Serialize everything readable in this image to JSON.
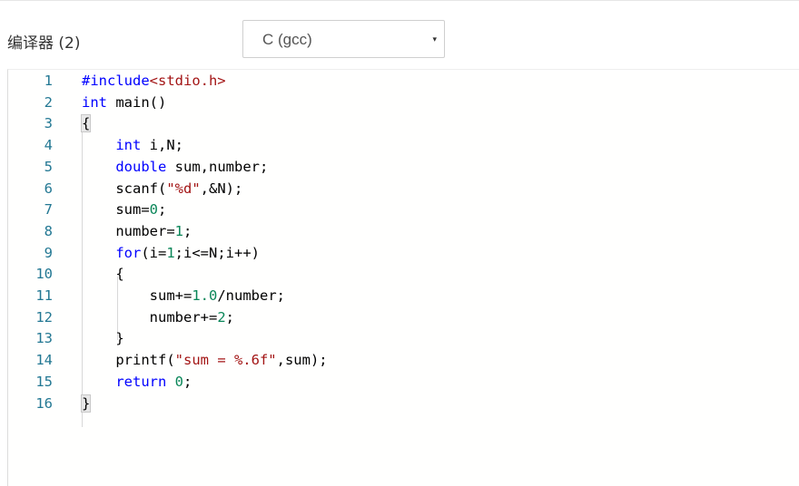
{
  "compiler": {
    "label": "编译器 (2)",
    "selected": "C (gcc)",
    "caret": "▾"
  },
  "editor": {
    "lines": [
      {
        "number": "1",
        "tokens": [
          {
            "t": "#include",
            "c": "pp"
          },
          {
            "t": "<stdio.h>",
            "c": "inc"
          }
        ]
      },
      {
        "number": "2",
        "tokens": [
          {
            "t": "int",
            "c": "kw"
          },
          {
            "t": " main()",
            "c": "id"
          }
        ]
      },
      {
        "number": "3",
        "tokens": [
          {
            "t": "{",
            "c": "id",
            "hl": true
          }
        ]
      },
      {
        "number": "4",
        "tokens": [
          {
            "t": "    ",
            "c": "id"
          },
          {
            "t": "int",
            "c": "kw"
          },
          {
            "t": " i,N;",
            "c": "id"
          }
        ]
      },
      {
        "number": "5",
        "tokens": [
          {
            "t": "    ",
            "c": "id"
          },
          {
            "t": "double",
            "c": "kw"
          },
          {
            "t": " sum,number;",
            "c": "id"
          }
        ]
      },
      {
        "number": "6",
        "tokens": [
          {
            "t": "    scanf(",
            "c": "id"
          },
          {
            "t": "\"%d\"",
            "c": "str"
          },
          {
            "t": ",&N);",
            "c": "id"
          }
        ]
      },
      {
        "number": "7",
        "tokens": [
          {
            "t": "    sum=",
            "c": "id"
          },
          {
            "t": "0",
            "c": "num"
          },
          {
            "t": ";",
            "c": "id"
          }
        ]
      },
      {
        "number": "8",
        "tokens": [
          {
            "t": "    number=",
            "c": "id"
          },
          {
            "t": "1",
            "c": "num"
          },
          {
            "t": ";",
            "c": "id"
          }
        ]
      },
      {
        "number": "9",
        "tokens": [
          {
            "t": "    ",
            "c": "id"
          },
          {
            "t": "for",
            "c": "kw"
          },
          {
            "t": "(i=",
            "c": "id"
          },
          {
            "t": "1",
            "c": "num"
          },
          {
            "t": ";i<=N;i++)",
            "c": "id"
          }
        ]
      },
      {
        "number": "10",
        "tokens": [
          {
            "t": "    {",
            "c": "id"
          }
        ]
      },
      {
        "number": "11",
        "tokens": [
          {
            "t": "        sum+=",
            "c": "id"
          },
          {
            "t": "1.0",
            "c": "num"
          },
          {
            "t": "/number;",
            "c": "id"
          }
        ]
      },
      {
        "number": "12",
        "tokens": [
          {
            "t": "        number+=",
            "c": "id"
          },
          {
            "t": "2",
            "c": "num"
          },
          {
            "t": ";",
            "c": "id"
          }
        ]
      },
      {
        "number": "13",
        "tokens": [
          {
            "t": "    }",
            "c": "id"
          }
        ]
      },
      {
        "number": "14",
        "tokens": [
          {
            "t": "    printf(",
            "c": "id"
          },
          {
            "t": "\"sum = %.6f\"",
            "c": "str"
          },
          {
            "t": ",sum);",
            "c": "id"
          }
        ]
      },
      {
        "number": "15",
        "tokens": [
          {
            "t": "    ",
            "c": "id"
          },
          {
            "t": "return",
            "c": "kw"
          },
          {
            "t": " ",
            "c": "id"
          },
          {
            "t": "0",
            "c": "num"
          },
          {
            "t": ";",
            "c": "id"
          }
        ]
      },
      {
        "number": "16",
        "tokens": [
          {
            "t": "}",
            "c": "id",
            "hl": true
          }
        ]
      }
    ],
    "colors": {
      "keyword": "#0000ff",
      "string": "#a31515",
      "number": "#098658",
      "line_number": "#237893"
    }
  }
}
